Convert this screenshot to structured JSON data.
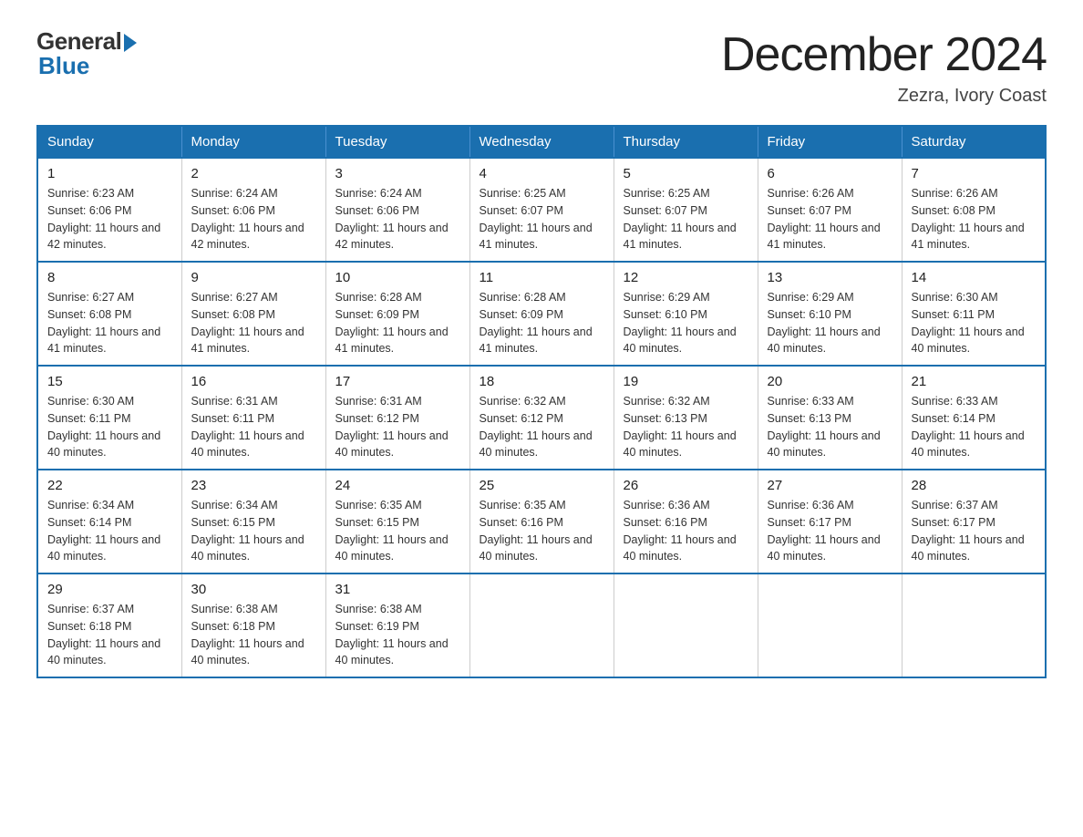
{
  "logo": {
    "general": "General",
    "blue": "Blue"
  },
  "header": {
    "month_title": "December 2024",
    "subtitle": "Zezra, Ivory Coast"
  },
  "calendar": {
    "days_of_week": [
      "Sunday",
      "Monday",
      "Tuesday",
      "Wednesday",
      "Thursday",
      "Friday",
      "Saturday"
    ],
    "weeks": [
      [
        {
          "day": "1",
          "sunrise": "6:23 AM",
          "sunset": "6:06 PM",
          "daylight": "11 hours and 42 minutes."
        },
        {
          "day": "2",
          "sunrise": "6:24 AM",
          "sunset": "6:06 PM",
          "daylight": "11 hours and 42 minutes."
        },
        {
          "day": "3",
          "sunrise": "6:24 AM",
          "sunset": "6:06 PM",
          "daylight": "11 hours and 42 minutes."
        },
        {
          "day": "4",
          "sunrise": "6:25 AM",
          "sunset": "6:07 PM",
          "daylight": "11 hours and 41 minutes."
        },
        {
          "day": "5",
          "sunrise": "6:25 AM",
          "sunset": "6:07 PM",
          "daylight": "11 hours and 41 minutes."
        },
        {
          "day": "6",
          "sunrise": "6:26 AM",
          "sunset": "6:07 PM",
          "daylight": "11 hours and 41 minutes."
        },
        {
          "day": "7",
          "sunrise": "6:26 AM",
          "sunset": "6:08 PM",
          "daylight": "11 hours and 41 minutes."
        }
      ],
      [
        {
          "day": "8",
          "sunrise": "6:27 AM",
          "sunset": "6:08 PM",
          "daylight": "11 hours and 41 minutes."
        },
        {
          "day": "9",
          "sunrise": "6:27 AM",
          "sunset": "6:08 PM",
          "daylight": "11 hours and 41 minutes."
        },
        {
          "day": "10",
          "sunrise": "6:28 AM",
          "sunset": "6:09 PM",
          "daylight": "11 hours and 41 minutes."
        },
        {
          "day": "11",
          "sunrise": "6:28 AM",
          "sunset": "6:09 PM",
          "daylight": "11 hours and 41 minutes."
        },
        {
          "day": "12",
          "sunrise": "6:29 AM",
          "sunset": "6:10 PM",
          "daylight": "11 hours and 40 minutes."
        },
        {
          "day": "13",
          "sunrise": "6:29 AM",
          "sunset": "6:10 PM",
          "daylight": "11 hours and 40 minutes."
        },
        {
          "day": "14",
          "sunrise": "6:30 AM",
          "sunset": "6:11 PM",
          "daylight": "11 hours and 40 minutes."
        }
      ],
      [
        {
          "day": "15",
          "sunrise": "6:30 AM",
          "sunset": "6:11 PM",
          "daylight": "11 hours and 40 minutes."
        },
        {
          "day": "16",
          "sunrise": "6:31 AM",
          "sunset": "6:11 PM",
          "daylight": "11 hours and 40 minutes."
        },
        {
          "day": "17",
          "sunrise": "6:31 AM",
          "sunset": "6:12 PM",
          "daylight": "11 hours and 40 minutes."
        },
        {
          "day": "18",
          "sunrise": "6:32 AM",
          "sunset": "6:12 PM",
          "daylight": "11 hours and 40 minutes."
        },
        {
          "day": "19",
          "sunrise": "6:32 AM",
          "sunset": "6:13 PM",
          "daylight": "11 hours and 40 minutes."
        },
        {
          "day": "20",
          "sunrise": "6:33 AM",
          "sunset": "6:13 PM",
          "daylight": "11 hours and 40 minutes."
        },
        {
          "day": "21",
          "sunrise": "6:33 AM",
          "sunset": "6:14 PM",
          "daylight": "11 hours and 40 minutes."
        }
      ],
      [
        {
          "day": "22",
          "sunrise": "6:34 AM",
          "sunset": "6:14 PM",
          "daylight": "11 hours and 40 minutes."
        },
        {
          "day": "23",
          "sunrise": "6:34 AM",
          "sunset": "6:15 PM",
          "daylight": "11 hours and 40 minutes."
        },
        {
          "day": "24",
          "sunrise": "6:35 AM",
          "sunset": "6:15 PM",
          "daylight": "11 hours and 40 minutes."
        },
        {
          "day": "25",
          "sunrise": "6:35 AM",
          "sunset": "6:16 PM",
          "daylight": "11 hours and 40 minutes."
        },
        {
          "day": "26",
          "sunrise": "6:36 AM",
          "sunset": "6:16 PM",
          "daylight": "11 hours and 40 minutes."
        },
        {
          "day": "27",
          "sunrise": "6:36 AM",
          "sunset": "6:17 PM",
          "daylight": "11 hours and 40 minutes."
        },
        {
          "day": "28",
          "sunrise": "6:37 AM",
          "sunset": "6:17 PM",
          "daylight": "11 hours and 40 minutes."
        }
      ],
      [
        {
          "day": "29",
          "sunrise": "6:37 AM",
          "sunset": "6:18 PM",
          "daylight": "11 hours and 40 minutes."
        },
        {
          "day": "30",
          "sunrise": "6:38 AM",
          "sunset": "6:18 PM",
          "daylight": "11 hours and 40 minutes."
        },
        {
          "day": "31",
          "sunrise": "6:38 AM",
          "sunset": "6:19 PM",
          "daylight": "11 hours and 40 minutes."
        },
        null,
        null,
        null,
        null
      ]
    ]
  }
}
